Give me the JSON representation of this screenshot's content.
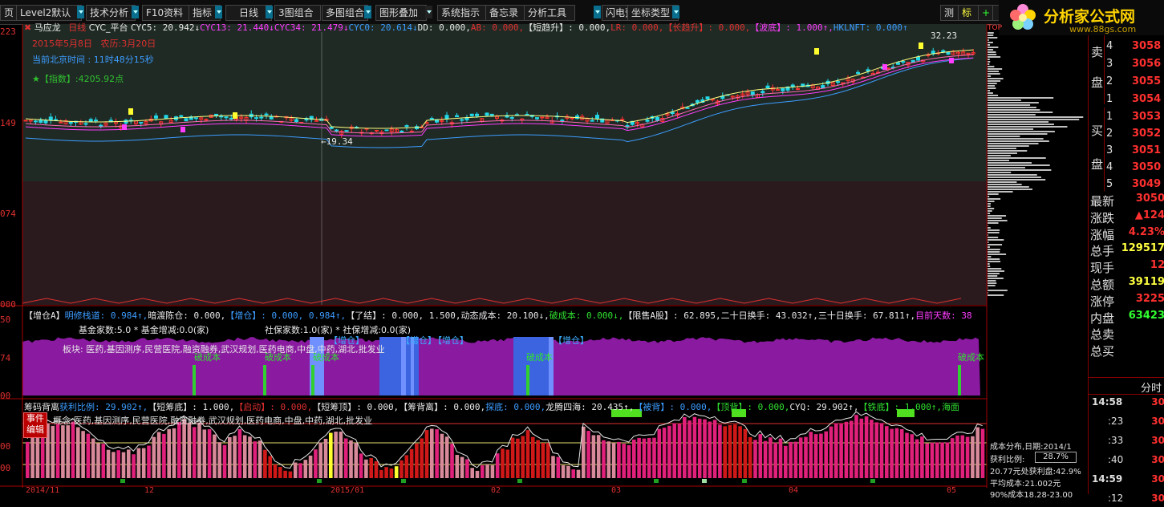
{
  "toolbar": {
    "items": [
      "页",
      "Level2默认",
      "技术分析",
      "F10资料",
      "指标",
      "日线",
      "3图组合",
      "多图组合",
      "图形叠加",
      "系统指示",
      "备忘录",
      "分析工具",
      "闪电预警",
      "坐标类型",
      "测",
      "标"
    ]
  },
  "logo": {
    "name": "分析家公式网",
    "url": "www.88gs.com",
    "top": "TOP"
  },
  "main": {
    "stock_name": "马应龙",
    "period": "日线",
    "formula": "CYC_平台",
    "indicators": [
      {
        "t": "CYC5: 20.942↓",
        "c": "#e8e8e8"
      },
      {
        "t": "CYC13: 21.440↓",
        "c": "#ff3cff"
      },
      {
        "t": "CYC34: 21.479↓",
        "c": "#ff3cff"
      },
      {
        "t": "CYC0: 20.614↓",
        "c": "#3c9cff"
      },
      {
        "t": "DD: 0.000,",
        "c": "#e8e8e8"
      },
      {
        "t": "AB: 0.000,",
        "c": "#e03030"
      },
      {
        "t": "【短趋升】: 0.000,",
        "c": "#e8e8e8"
      },
      {
        "t": "LR: 0.000,",
        "c": "#e03030"
      },
      {
        "t": "【长趋升】: 0.000,",
        "c": "#e03030"
      },
      {
        "t": "【波底】: 1.000↑,",
        "c": "#ff3cff"
      },
      {
        "t": "HKLNFT: 0.000↑",
        "c": "#3c9cff"
      }
    ],
    "date": "2015年5月8日",
    "lunar": "农历:3月20日",
    "time_label": "当前北京时间",
    "time": "11时48分15秒",
    "index_label": "★【指数】",
    "index_value": ":4205.92点",
    "axis": [
      "223",
      "149",
      "074",
      "000"
    ],
    "high_label": "32.23",
    "low_label": "19.34"
  },
  "panel2": {
    "indicators": [
      {
        "t": "【增仓A】",
        "c": "#e8e8e8"
      },
      {
        "t": "明修栈道: 0.984↑,",
        "c": "#3c9cff"
      },
      {
        "t": "暗渡陈仓: 0.000,",
        "c": "#e8e8e8"
      },
      {
        "t": "【增仓】: 0.000, 0.984↑,",
        "c": "#3c9cff"
      },
      {
        "t": "【了结】: 0.000, 1.500,",
        "c": "#e8e8e8"
      },
      {
        "t": "动态成本: 20.100↓,",
        "c": "#e8e8e8"
      },
      {
        "t": "破成本: 0.000↓,",
        "c": "#30e030"
      },
      {
        "t": "【限售A股】: 62.895,",
        "c": "#e8e8e8"
      },
      {
        "t": "二十日换手: 43.032↑,",
        "c": "#e8e8e8"
      },
      {
        "t": "三十日换手: 67.811↑,",
        "c": "#e8e8e8"
      },
      {
        "t": "目前天数: 38",
        "c": "#ff3cff"
      }
    ],
    "fund_line": "基金家数:5.0 * 基金增减:0.0(家)",
    "social_line": "社保家数:1.0(家) * 社保增减:0.0(家)",
    "sector_line": "板块:  医药,基因测序,民营医院,融资融券,武汉规划,医药电商,中盘,中药,湖北,批发业",
    "labels": {
      "zengcang": "【增仓】",
      "pochengben": "破成本"
    },
    "axis": [
      "50",
      "74",
      "00"
    ]
  },
  "panel3": {
    "indicators": [
      {
        "t": "筹码背离",
        "c": "#e8e8e8"
      },
      {
        "t": "获利比例: 29.902↑,",
        "c": "#3c9cff"
      },
      {
        "t": "【短筹底】: 1.000,",
        "c": "#e8e8e8"
      },
      {
        "t": "【启动】: 0.000,",
        "c": "#e03030"
      },
      {
        "t": "【短筹顶】: 0.000,",
        "c": "#e8e8e8"
      },
      {
        "t": "【筹背离】: 0.000,",
        "c": "#e8e8e8"
      },
      {
        "t": "探底: 0.000,",
        "c": "#3c9cff"
      },
      {
        "t": "龙腾四海: 20.435↑,",
        "c": "#e8e8e8"
      },
      {
        "t": "【被背】: 0.000,",
        "c": "#3c9cff"
      },
      {
        "t": "【顶背】: 0.000,",
        "c": "#30e030"
      },
      {
        "t": "CYQ: 29.902↑,",
        "c": "#e8e8e8"
      },
      {
        "t": "【铁底】: 1.000↑,",
        "c": "#30e030"
      },
      {
        "t": "海面",
        "c": "#30e030"
      }
    ],
    "board": "概念:医药,基因测序,民营医院,融资融券,武汉规划,医药电商,中盘,中药,湖北,批发业",
    "btn1": "事件",
    "btn2": "编辑",
    "axis": [
      "00",
      "00"
    ],
    "dates": [
      "2014/11",
      "12",
      "2015/01",
      "02",
      "03",
      "04",
      "05"
    ]
  },
  "cost": {
    "title": "成本分布,日期:2014/1",
    "ratio_label": "获利比例:",
    "ratio_value": "28.7%",
    "line1": "20.77元处获利盘:42.9%",
    "line2": "平均成本:21.002元",
    "line3": "90%成本18.28-23.00"
  },
  "right": {
    "sell_label": [
      "卖",
      "盘"
    ],
    "buy_label": [
      "买",
      "盘"
    ],
    "sell": [
      {
        "n": "4",
        "p": "3058"
      },
      {
        "n": "3",
        "p": "3056"
      },
      {
        "n": "2",
        "p": "3055"
      },
      {
        "n": "1",
        "p": "3054"
      }
    ],
    "buy": [
      {
        "n": "1",
        "p": "3053"
      },
      {
        "n": "2",
        "p": "3052"
      },
      {
        "n": "3",
        "p": "3051"
      },
      {
        "n": "4",
        "p": "3050"
      },
      {
        "n": "5",
        "p": "3049"
      }
    ],
    "stats": [
      {
        "k": "最新",
        "v": "3050",
        "c": "#ff3030"
      },
      {
        "k": "涨跌",
        "v": "▲124",
        "c": "#ff3030"
      },
      {
        "k": "涨幅",
        "v": "4.23%",
        "c": "#ff3030"
      },
      {
        "k": "总手",
        "v": "129517",
        "c": "#ffff40"
      },
      {
        "k": "现手",
        "v": "12",
        "c": "#ff3030"
      },
      {
        "k": "总额",
        "v": "39119",
        "c": "#ffff40"
      },
      {
        "k": "涨停",
        "v": "3225",
        "c": "#ff3030"
      },
      {
        "k": "内盘",
        "v": "63423",
        "c": "#30ff30"
      },
      {
        "k": "总卖",
        "v": "",
        "c": "#e0e0e0"
      },
      {
        "k": "总买",
        "v": "",
        "c": "#e0e0e0"
      }
    ],
    "tick_header": "分时",
    "ticks": [
      {
        "t": "14:58",
        "v": "30"
      },
      {
        "t": ":23",
        "v": "30"
      },
      {
        "t": ":33",
        "v": "30"
      },
      {
        "t": ":40",
        "v": "30"
      },
      {
        "t": "14:59",
        "v": "30"
      },
      {
        "t": ":12",
        "v": "30"
      }
    ]
  }
}
